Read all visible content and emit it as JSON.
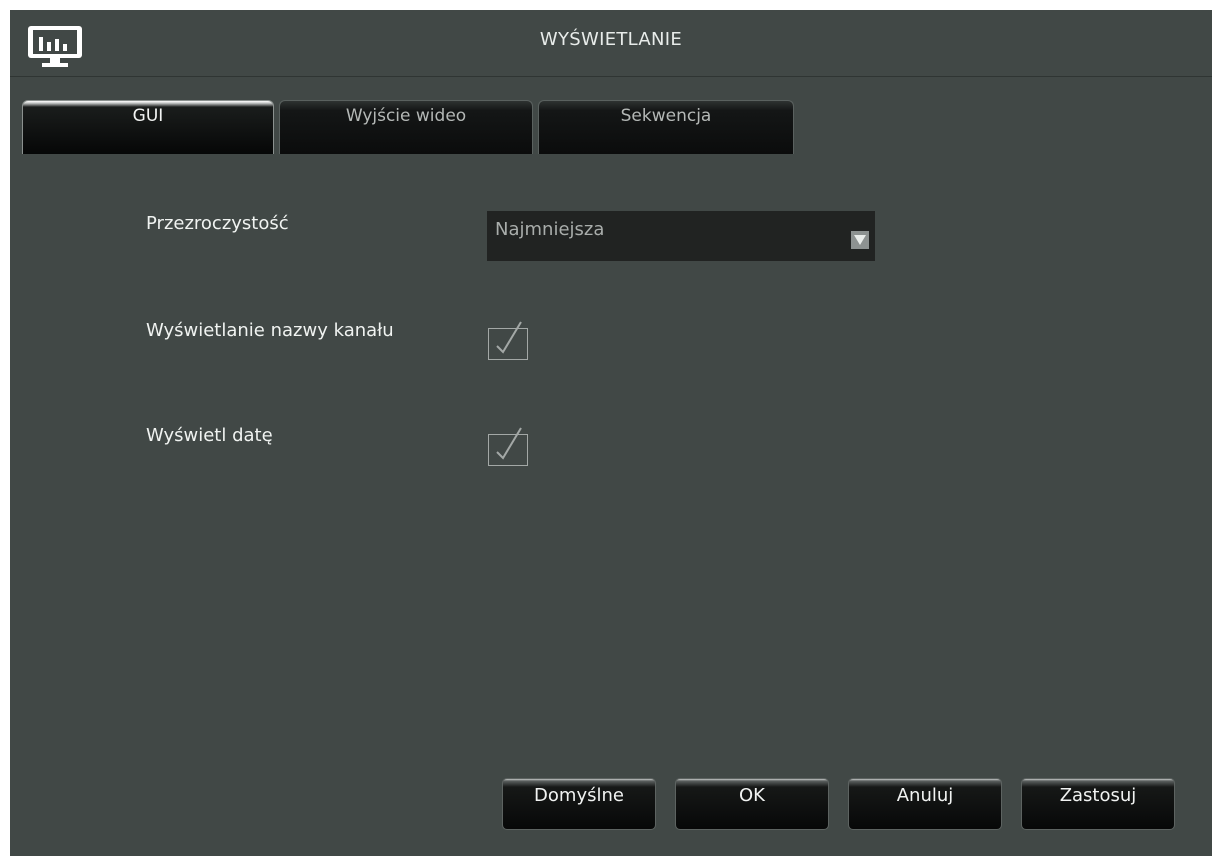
{
  "window": {
    "title": "WYŚWIETLANIE",
    "icon": "monitor-chart-icon"
  },
  "tabs": [
    {
      "label": "GUI",
      "active": true
    },
    {
      "label": "Wyjście wideo",
      "active": false
    },
    {
      "label": "Sekwencja",
      "active": false
    }
  ],
  "settings": {
    "transparency": {
      "label": "Przezroczystość",
      "value": "Najmniejsza"
    },
    "channel_name": {
      "label": "Wyświetlanie nazwy kanału",
      "checked": true
    },
    "show_date": {
      "label": "Wyświetl datę",
      "checked": true
    }
  },
  "buttons": {
    "default": "Domyślne",
    "ok": "OK",
    "cancel": "Anuluj",
    "apply": "Zastosuj"
  },
  "colors": {
    "background": "#414846",
    "dropdown": "#212322",
    "text": "#f0f3f1"
  }
}
